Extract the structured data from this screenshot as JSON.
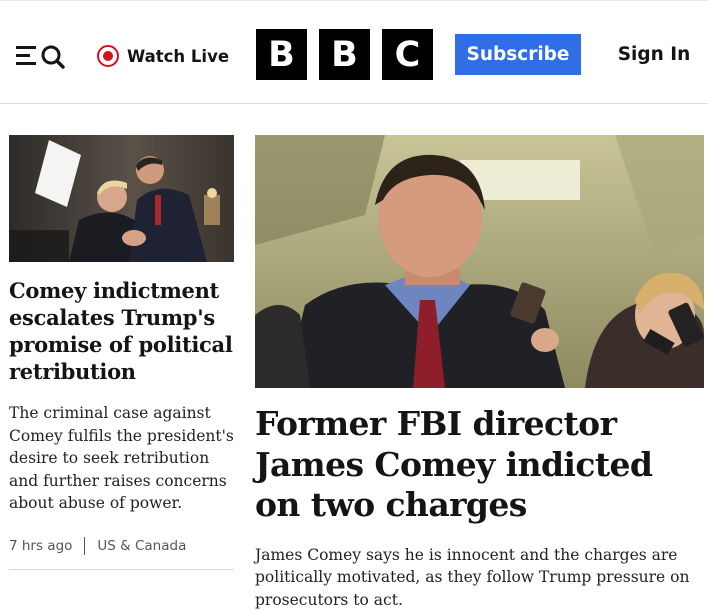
{
  "header": {
    "watch_live_label": "Watch Live",
    "logo_letters": [
      "B",
      "B",
      "C"
    ],
    "subscribe_label": "Subscribe",
    "sign_in_label": "Sign In",
    "menu_icon": "menu-search-icon",
    "live_icon": "live-record-icon"
  },
  "left_story": {
    "headline": "Comey indictment escalates Trump's promise of political retribution",
    "summary": "The criminal case against Comey fulfils the president's desire to seek retribution and further raises concerns about abuse of power.",
    "timestamp": "7 hrs ago",
    "category": "US & Canada"
  },
  "main_story": {
    "headline": "Former FBI director James Comey indicted on two charges",
    "summary": "James Comey says he is innocent and the charges are politically motivated, as they follow Trump pressure on prosecutors to act."
  },
  "colors": {
    "accent_live": "#d4111e",
    "subscribe_bg": "#2f6ee7",
    "text": "#141414"
  }
}
